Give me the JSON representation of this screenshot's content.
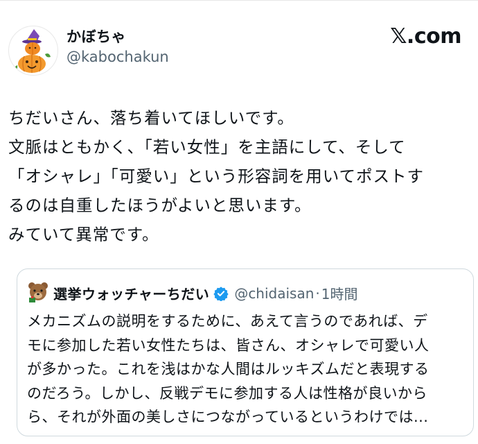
{
  "post": {
    "author": {
      "display_name": "かぼちゃ",
      "handle": "@kabochakun",
      "avatar_icon": "pumpkin-witch-hat-avatar"
    },
    "brand": "𝕏.com",
    "body_lines": [
      "ちだいさん、落ち着いてほしいです。",
      "文脈はともかく、「若い女性」を主語にして、そして",
      "「オシャレ」「可愛い」という形容詞を用いてポストす",
      "るのは自重したほうがよいと思います。",
      "みていて異常です。"
    ]
  },
  "quoted_post": {
    "author": {
      "display_name": "選挙ウォッチャーちだい",
      "handle": "@chidaisan",
      "verified": true,
      "avatar_icon": "bear-avatar"
    },
    "separator": "·",
    "time": "1時間",
    "body_lines": [
      "メカニズムの説明をするために、あえて言うのであれば、デ",
      "モに参加した若い女性たちは、皆さん、オシャレで可愛い人",
      "が多かった。これを浅はかな人間はルッキズムだと表現する",
      "のだろう。しかし、反戦デモに参加する人は性格が良いから",
      "ら、それが外面の美しさにつながっているというわけでは..."
    ]
  },
  "colors": {
    "text": "#0f1419",
    "secondary": "#536471",
    "verified": "#1d9bf0",
    "border": "#cfd9de"
  }
}
